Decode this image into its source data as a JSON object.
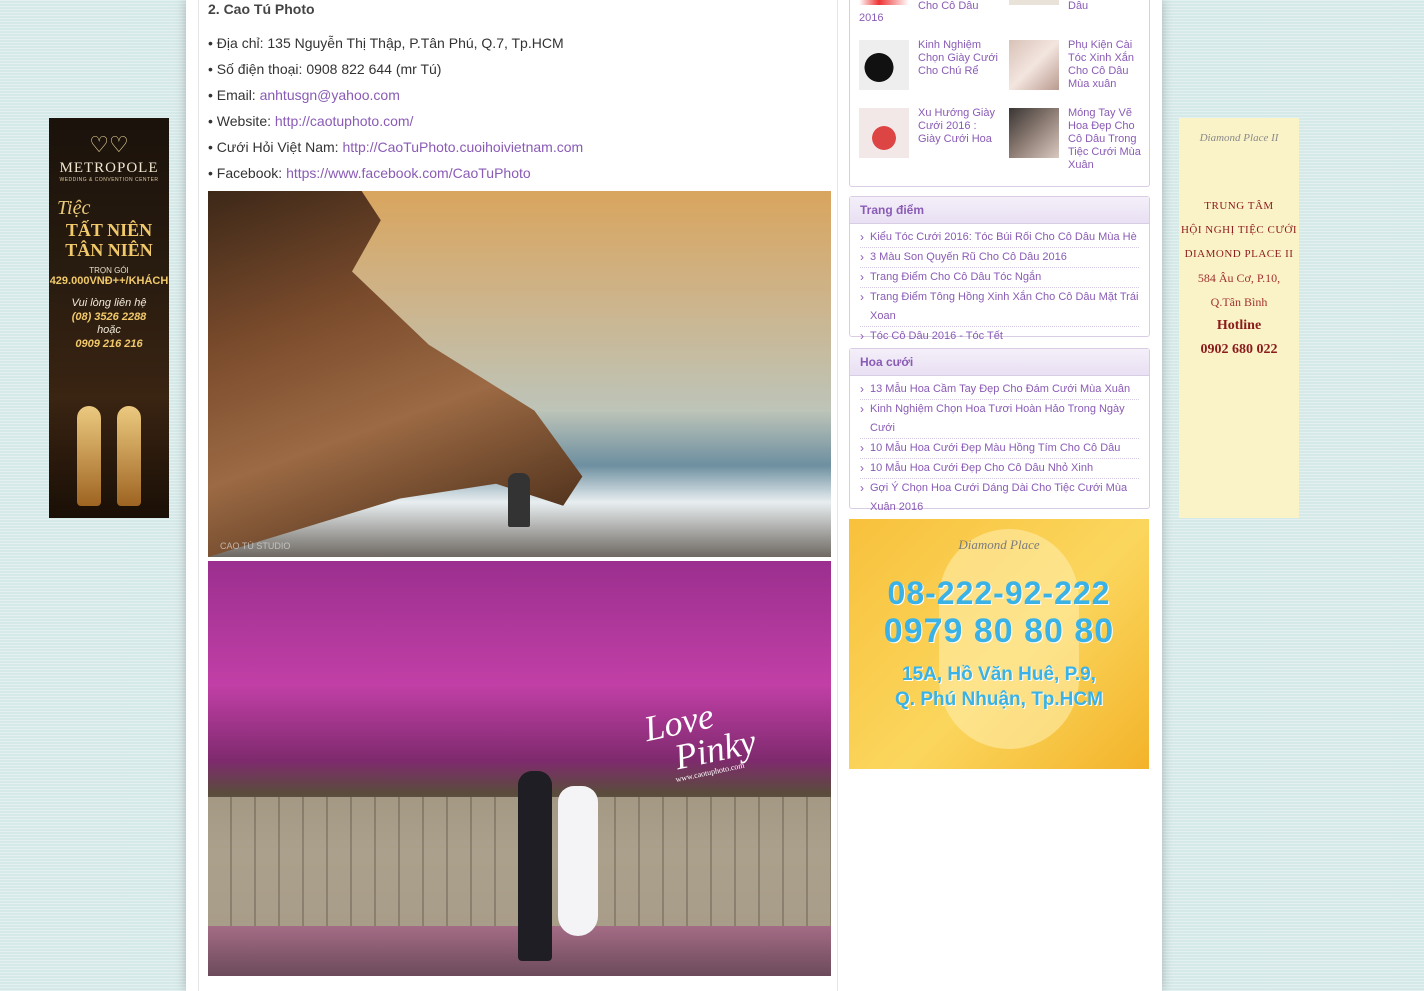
{
  "article": {
    "section_title": "2. Cao Tú Photo",
    "address_label": "• Địa chỉ:",
    "address": "135 Nguyễn Thị Thập, P.Tân Phú, Q.7, Tp.HCM",
    "phone_label": "• Số điện thoại:",
    "phone": "0908 822 644 (mr Tú)",
    "email_label": "• Email:",
    "email": "anhtusgn@yahoo.com",
    "website_label": "• Website:",
    "website": "http://caotuphoto.com/",
    "cuoihoi_label": "• Cưới Hỏi Việt Nam:",
    "cuoihoi": "http://CaoTuPhoto.cuoihoivietnam.com",
    "facebook_label": "• Facebook:",
    "facebook": "https://www.facebook.com/CaoTuPhoto",
    "photo1_caption": "CAO TÚ STUDIO",
    "photo2_overlay_love": "Love",
    "photo2_overlay_pinky": "Pinky",
    "photo2_overlay_url": "www.caotuphoto.com"
  },
  "sidebar": {
    "posts": [
      {
        "title": "Cho Cô Dâu",
        "prefix": "2016"
      },
      {
        "title": "Dâu"
      },
      {
        "title": "Kinh Nghiệm Chọn Giày Cưới Cho Chú Rể"
      },
      {
        "title": "Phụ Kiện Cài Tóc Xinh Xắn Cho Cô Dâu Mùa xuân"
      },
      {
        "title": "Xu Hướng Giày Cưới 2016 : Giày Cưới Hoa"
      },
      {
        "title": "Móng Tay Vẽ Hoa Đẹp Cho Cô Dâu Trong Tiệc Cưới Mùa Xuân"
      }
    ],
    "trang_diem": {
      "title": "Trang điểm",
      "items": [
        "Kiểu Tóc Cưới 2016: Tóc Búi Rối Cho Cô Dâu Mùa Hè",
        "3 Màu Son Quyến Rũ Cho Cô Dâu 2016",
        "Trang Điểm Cho Cô Dâu Tóc Ngắn",
        "Trang Điểm Tông Hồng Xinh Xắn Cho Cô Dâu Mặt Trái Xoan",
        "Tóc Cô Dâu 2016 - Tóc Tết"
      ]
    },
    "hoa_cuoi": {
      "title": "Hoa cưới",
      "items": [
        "13 Mẫu Hoa Cầm Tay Đẹp Cho Đám Cưới Mùa Xuân",
        "Kinh Nghiệm Chọn Hoa Tươi Hoàn Hảo Trong Ngày Cưới",
        "10 Mẫu Hoa Cưới Đẹp Màu Hồng Tím Cho Cô Dâu",
        "10 Mẫu Hoa Cưới Đẹp Cho Cô Dâu Nhỏ Xinh",
        "Gợi Ý Chọn Hoa Cưới Dáng Dài Cho Tiệc Cưới Mùa Xuân 2016"
      ]
    },
    "ad_diamond": {
      "logo": "Diamond Place",
      "phone1": "08-222-92-222",
      "phone2": "0979 80 80 80",
      "address_line1": "15A, Hồ Văn Huê, P.9,",
      "address_line2": "Q. Phú Nhuận, Tp.HCM"
    }
  },
  "ad_left": {
    "brand": "METROPOLE",
    "brand_sub": "WEDDING & CONVENTION CENTER",
    "tiec": "Tiệc",
    "line1": "TẤT NIÊN",
    "line2": "TÂN NIÊN",
    "tron_goi": "TRỌN GÓI",
    "price": "429.000VNĐ++/KHÁCH",
    "contact": "Vui lòng liên hệ",
    "phone1": "(08) 3526 2288",
    "hoac": "hoặc",
    "phone2": "0909 216 216"
  },
  "ad_right": {
    "logo": "Diamond Place II",
    "line1": "TRUNG TÂM",
    "line2": "HỘI NGHỊ TIỆC CƯỚI",
    "line3": "DIAMOND PLACE II",
    "addr1": "584 Âu Cơ, P.10,",
    "addr2": "Q.Tân Bình",
    "hotline_label": "Hotline",
    "hotline": "0902 680 022"
  },
  "colors": {
    "link": "#8a5bb5",
    "page_bg": "#d6e9e9",
    "ad_phone_blue": "#3ab2e6"
  }
}
